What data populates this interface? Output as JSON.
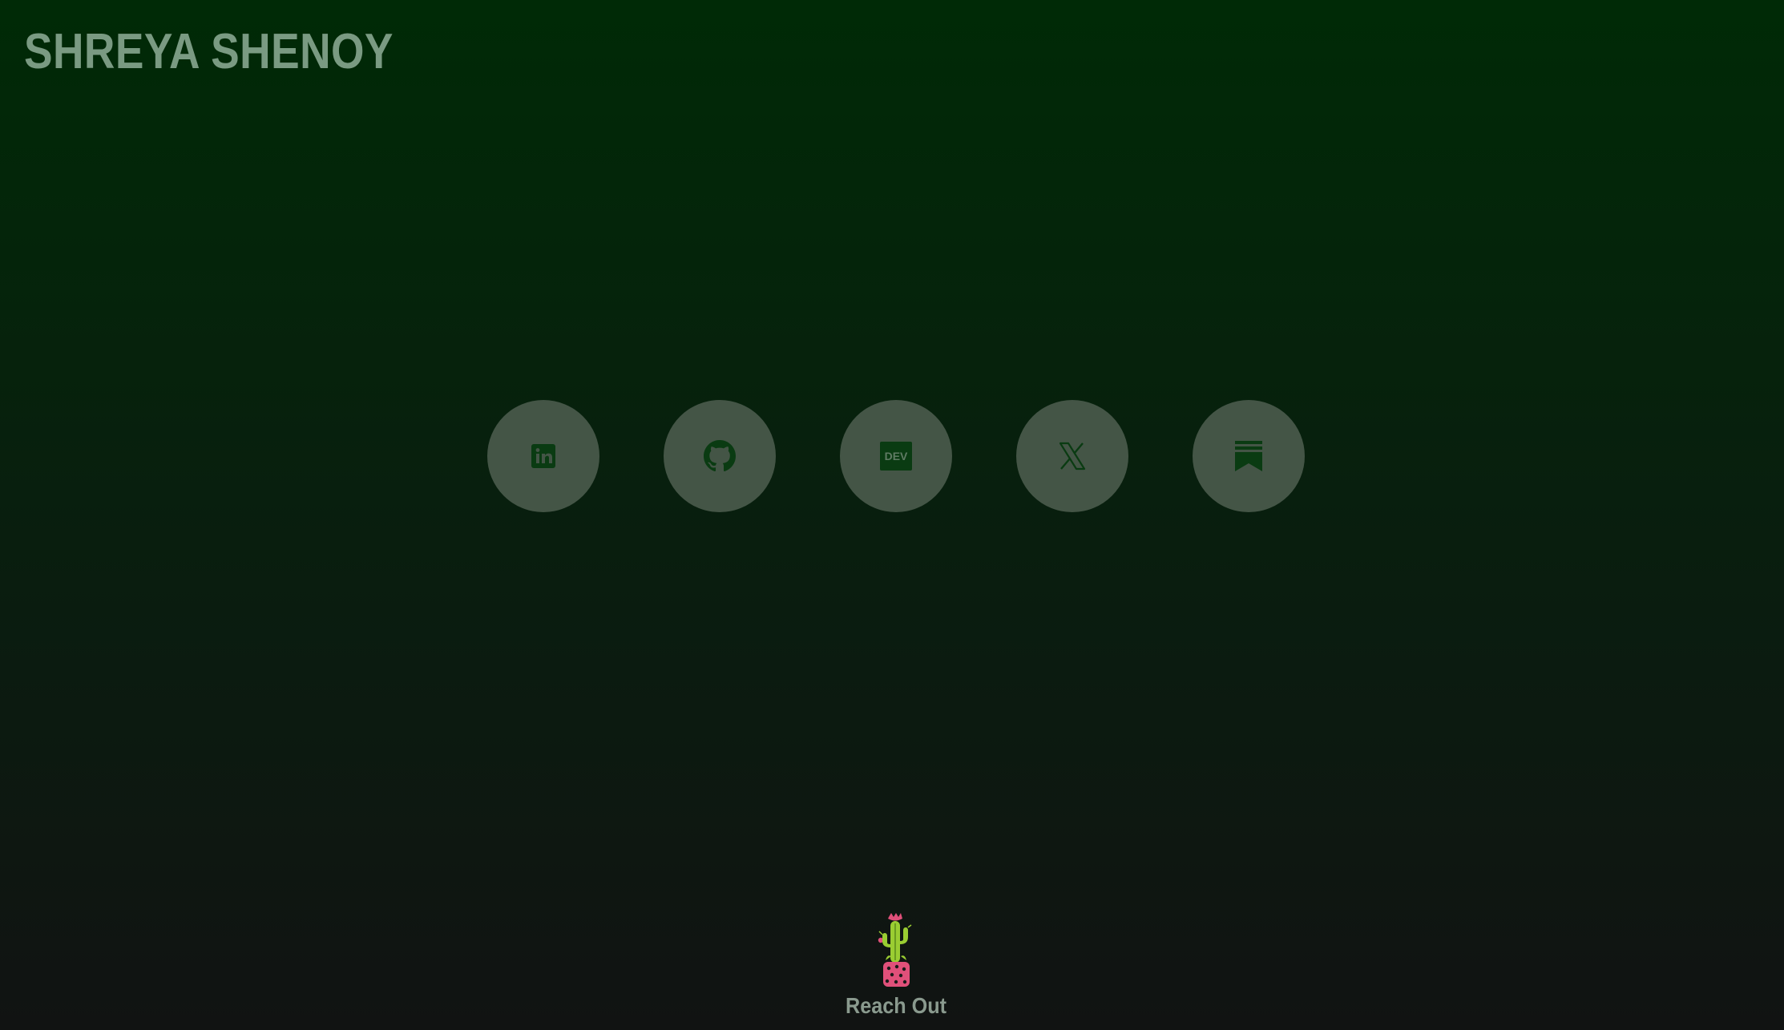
{
  "header": {
    "title": "SHREYA SHENOY"
  },
  "socials": [
    {
      "name": "LinkedIn",
      "icon": "linkedin-icon"
    },
    {
      "name": "GitHub",
      "icon": "github-icon"
    },
    {
      "name": "DEV",
      "icon": "dev-icon",
      "icon_text": "DEV"
    },
    {
      "name": "X",
      "icon": "x-icon"
    },
    {
      "name": "Substack",
      "icon": "substack-icon"
    }
  ],
  "footer": {
    "icon": "cactus-icon",
    "label": "Reach Out"
  },
  "colors": {
    "background_top": "#002a06",
    "background_bottom": "#111312",
    "title": "#7a9a82",
    "circle": "#445546",
    "icon": "#0a3b12",
    "cactus_pot": "#e0507a",
    "cactus_plant": "#9acd32"
  }
}
